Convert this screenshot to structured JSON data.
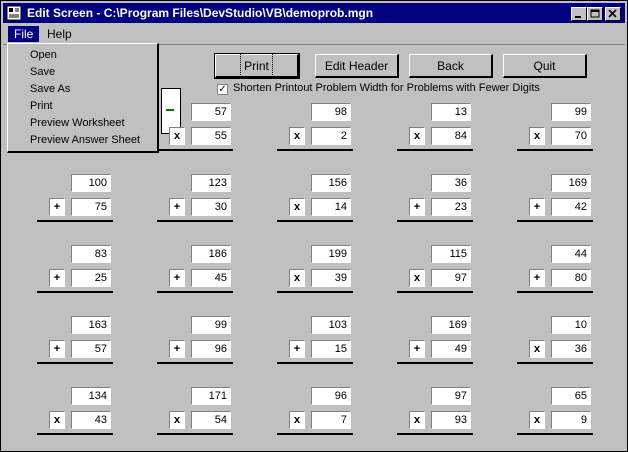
{
  "window": {
    "title": "Edit Screen - C:\\Program Files\\DevStudio\\VB\\demoprob.mgn"
  },
  "menubar": {
    "file": "File",
    "help": "Help"
  },
  "file_menu": {
    "items": [
      "Open",
      "Save",
      "Save As",
      "Print",
      "Preview Worksheet",
      "Preview Answer Sheet"
    ]
  },
  "toolbar": {
    "print": "Print",
    "edit_header": "Edit Header",
    "back": "Back",
    "quit": "Quit"
  },
  "option": {
    "checked": true,
    "label": "Shorten Printout Problem Width for Problems with Fewer Digits"
  },
  "problems": [
    {
      "top": "",
      "op": "",
      "bottom": ""
    },
    {
      "top": "57",
      "op": "x",
      "bottom": "55"
    },
    {
      "top": "98",
      "op": "x",
      "bottom": "2"
    },
    {
      "top": "13",
      "op": "x",
      "bottom": "84"
    },
    {
      "top": "99",
      "op": "x",
      "bottom": "70"
    },
    {
      "top": "100",
      "op": "+",
      "bottom": "75"
    },
    {
      "top": "123",
      "op": "+",
      "bottom": "30"
    },
    {
      "top": "156",
      "op": "x",
      "bottom": "14"
    },
    {
      "top": "36",
      "op": "+",
      "bottom": "23"
    },
    {
      "top": "169",
      "op": "+",
      "bottom": "42"
    },
    {
      "top": "83",
      "op": "+",
      "bottom": "25"
    },
    {
      "top": "186",
      "op": "+",
      "bottom": "45"
    },
    {
      "top": "199",
      "op": "x",
      "bottom": "39"
    },
    {
      "top": "115",
      "op": "x",
      "bottom": "97"
    },
    {
      "top": "44",
      "op": "+",
      "bottom": "80"
    },
    {
      "top": "163",
      "op": "+",
      "bottom": "57"
    },
    {
      "top": "99",
      "op": "+",
      "bottom": "96"
    },
    {
      "top": "103",
      "op": "+",
      "bottom": "15"
    },
    {
      "top": "169",
      "op": "+",
      "bottom": "49"
    },
    {
      "top": "10",
      "op": "x",
      "bottom": "36"
    },
    {
      "top": "134",
      "op": "x",
      "bottom": "43"
    },
    {
      "top": "171",
      "op": "x",
      "bottom": "54"
    },
    {
      "top": "96",
      "op": "x",
      "bottom": "7"
    },
    {
      "top": "97",
      "op": "x",
      "bottom": "93"
    },
    {
      "top": "65",
      "op": "x",
      "bottom": "9"
    }
  ]
}
